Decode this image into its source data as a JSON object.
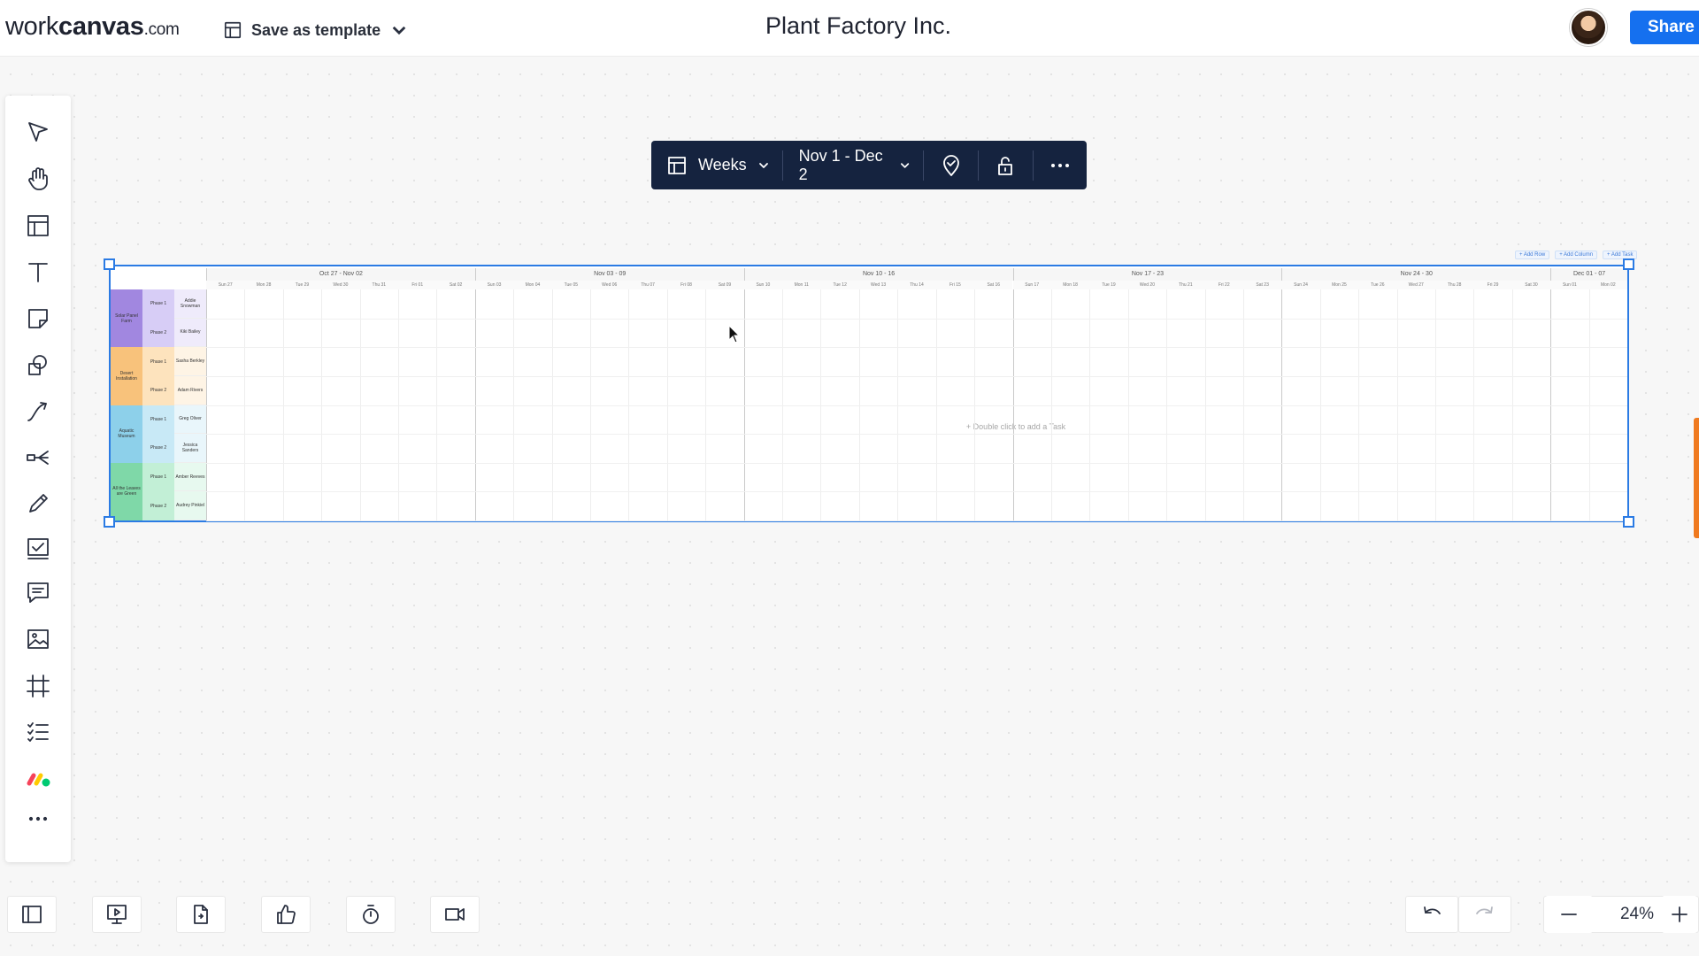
{
  "header": {
    "logo_light": "work",
    "logo_bold": "canvas",
    "logo_tld": ".com",
    "save_template_label": "Save as template",
    "document_title": "Plant Factory Inc.",
    "share_label": "Share"
  },
  "left_toolbar": {
    "tools": [
      "select-tool",
      "hand-tool",
      "template-tool",
      "text-tool",
      "sticky-note-tool",
      "shapes-tool",
      "connector-tool",
      "mind-map-tool",
      "pen-tool",
      "task-tool",
      "comment-tool",
      "image-tool",
      "frame-tool",
      "checklist-tool",
      "monday-integration",
      "more-tools"
    ]
  },
  "timeline_toolbar": {
    "view_label": "Weeks",
    "date_range": "Nov 1 - Dec 2"
  },
  "timeline": {
    "top_actions": [
      "+ Add Row",
      "+ Add Column",
      "+ Add Task"
    ],
    "weeks": [
      "Oct 27 - Nov 02",
      "Nov 03 - 09",
      "Nov 10 - 16",
      "Nov 17 - 23",
      "Nov 24 - 30",
      "Dec 01 - 07"
    ],
    "days": [
      [
        "Sun 27",
        "Mon 28",
        "Tue 29",
        "Wed 30",
        "Thu 31",
        "Fri 01",
        "Sat 02"
      ],
      [
        "Sun 03",
        "Mon 04",
        "Tue 05",
        "Wed 06",
        "Thu 07",
        "Fri 08",
        "Sat 09"
      ],
      [
        "Sun 10",
        "Mon 11",
        "Tue 12",
        "Wed 13",
        "Thu 14",
        "Fri 15",
        "Sat 16"
      ],
      [
        "Sun 17",
        "Mon 18",
        "Tue 19",
        "Wed 20",
        "Thu 21",
        "Fri 22",
        "Sat 23"
      ],
      [
        "Sun 24",
        "Mon 25",
        "Tue 26",
        "Wed 27",
        "Thu 28",
        "Fri 29",
        "Sat 30"
      ],
      [
        "Sun 01",
        "Mon 02"
      ]
    ],
    "projects": [
      {
        "name": "Solar Panel Farm",
        "color": "#a187e0",
        "light": "#d7cdf6",
        "phases": [
          "Phase 1",
          "Phase 2"
        ],
        "owners": [
          "Addie Snowman",
          "Kiki Bailey"
        ]
      },
      {
        "name": "Desert Installation",
        "color": "#f8c27b",
        "light": "#fde3bd",
        "phases": [
          "Phase 1",
          "Phase 2"
        ],
        "owners": [
          "Sasha Berkley",
          "Adam Rivers"
        ]
      },
      {
        "name": "Aquatic Museum",
        "color": "#8dd0ea",
        "light": "#c8e9f6",
        "phases": [
          "Phase 1",
          "Phase 2"
        ],
        "owners": [
          "Greg Oliver",
          "Jessica Sanders"
        ]
      },
      {
        "name": "All the Leaves are Green",
        "color": "#7fd8a8",
        "light": "#c2efd6",
        "phases": [
          "Phase 1",
          "Phase 2"
        ],
        "owners": [
          "Amber Reeves",
          "Audrey Pinkiel"
        ]
      }
    ],
    "empty_hint": "+ Double click to add a Task"
  },
  "bottom_bar": {
    "zoom": "24%"
  },
  "colors": {
    "accent": "#1570ef",
    "selection": "#2b7be4",
    "toolbar_bg": "#15233f",
    "side_tab": "#f07a1f"
  }
}
